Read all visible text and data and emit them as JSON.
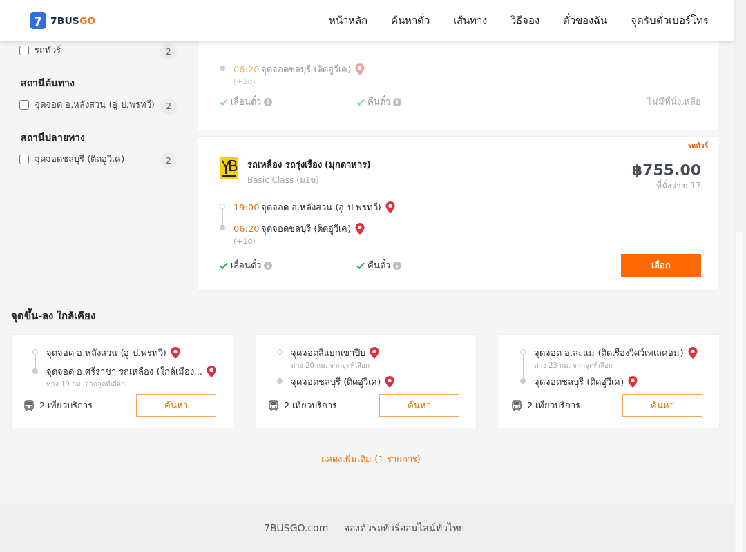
{
  "header": {
    "logo": {
      "icon_text": "7",
      "brand_main": "7BUS",
      "brand_accent": "GO"
    },
    "nav": [
      {
        "label": "หน้าหลัก"
      },
      {
        "label": "ค้นหาตั๋ว"
      },
      {
        "label": "เส้นทาง"
      },
      {
        "label": "วิธีจอง"
      },
      {
        "label": "ตั๋วของฉัน"
      },
      {
        "label": "จุดรับตั๋วเบอร์โทร"
      }
    ]
  },
  "sidebar": {
    "groups": [
      {
        "items": [
          {
            "label": "รถทัวร์",
            "count": "2",
            "checked": false
          }
        ]
      },
      {
        "title": "สถานีต้นทาง",
        "items": [
          {
            "label": "จุดจอด อ.หลังสวน (อู่ ป.พรทวี)",
            "count": "2",
            "checked": false
          }
        ]
      },
      {
        "title": "สถานีปลายทาง",
        "items": [
          {
            "label": "จุดจอดชลบุรี (ติดอู่วีเค)",
            "count": "2",
            "checked": false
          }
        ]
      }
    ]
  },
  "results": [
    {
      "sold_out": true,
      "stops": [
        {
          "time": "06:20",
          "place": "จุดจอดชลบุรี (ติดอู่วีเค)",
          "day_offset": "(+1d)"
        }
      ],
      "features": [
        {
          "label": "เลื่อนตั๋ว"
        },
        {
          "label": "คืนตั๋ว"
        }
      ],
      "availability": "ไม่มีที่นั่งเหลือ"
    },
    {
      "sold_out": false,
      "type_tag": "รถทัวร์",
      "operator": "รถเหลือง รถรุ่งเรือง (มุกดาหาร)",
      "bus_class": "Basic Class (ม1ข)",
      "price": "฿755.00",
      "seats": "ที่นั่งว่าง: 17",
      "stops": [
        {
          "time": "19:00",
          "place": "จุดจอด อ.หลังสวน (อู่ ป.พรทวี)"
        },
        {
          "time": "06:20",
          "place": "จุดจอดชลบุรี (ติดอู่วีเค)",
          "day_offset": "(+1d)"
        }
      ],
      "features": [
        {
          "label": "เลื่อนตั๋ว"
        },
        {
          "label": "คืนตั๋ว"
        }
      ],
      "button": "เลือก"
    }
  ],
  "nearby": {
    "title": "จุดขึ้น-ลง ใกล้เคียง",
    "cards": [
      {
        "stops": [
          {
            "place": "จุดจอด อ.หลังสวน (อู่ ป.พรทวี)"
          },
          {
            "place": "จุดจอด อ.ศรีราชา รถเหลือง (ใกล้เมือง...",
            "distance": "ห่าง 19 กม. จากจุดที่เลือก"
          }
        ],
        "trips": "2 เที่ยวบริการ",
        "button": "ค้นหา"
      },
      {
        "stops": [
          {
            "place": "จุดจอดสี่แยกเขาปีบ",
            "distance": "ห่าง 20 กม. จากจุดที่เลือก"
          },
          {
            "place": "จุดจอดชลบุรี (ติดอู่วีเค)"
          }
        ],
        "trips": "2 เที่ยวบริการ",
        "button": "ค้นหา"
      },
      {
        "stops": [
          {
            "place": "จุดจอด อ.ละแม (ติดเรืองวิศว์เทเลคอม)",
            "distance": "ห่าง 23 กม. จากจุดที่เลือก"
          },
          {
            "place": "จุดจอดชลบุรี (ติดอู่วีเค)"
          }
        ],
        "trips": "2 เที่ยวบริการ",
        "button": "ค้นหา"
      }
    ]
  },
  "show_more": "แสดงเพิ่มเติม (1 รายการ)",
  "footer": "7BUSGO.com — จองตั๋วรถทัวร์ออนไลน์ทั่วไทย"
}
